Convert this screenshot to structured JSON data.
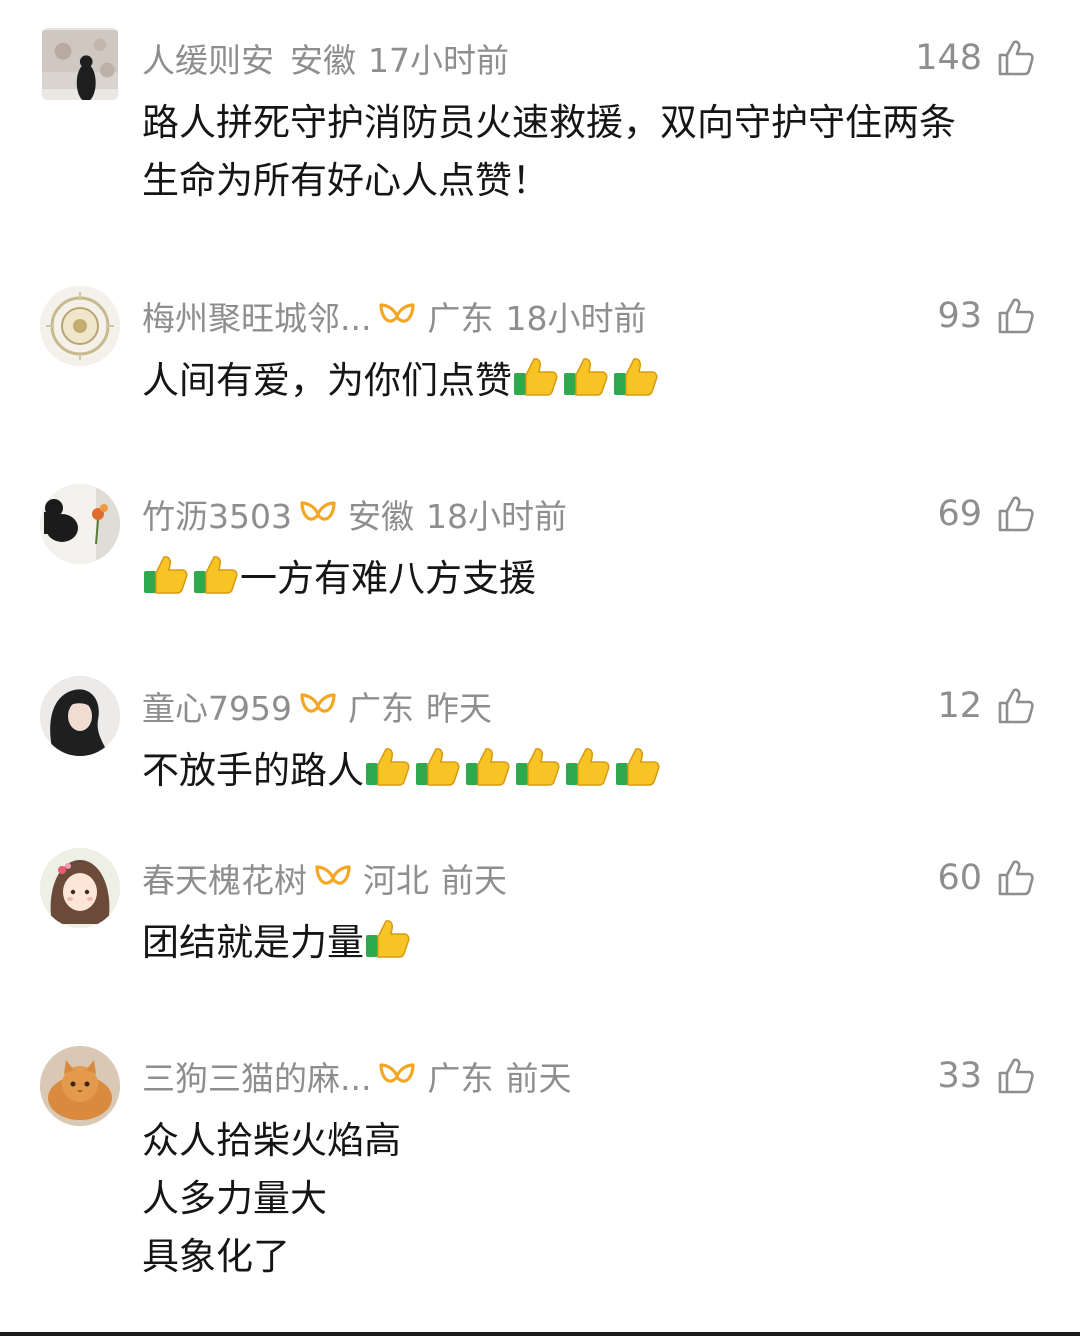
{
  "comments": [
    {
      "user": "人缓则安",
      "location": "安徽",
      "time": "17小时前",
      "likes": "148",
      "lines": [
        "路人拼死守护消防员火速救援，双向守护守住两条",
        "生命为所有好心人点赞！"
      ],
      "badge": false,
      "avatar": "photo-icon",
      "thumbs_after": 0,
      "thumbs_before": 0
    },
    {
      "user": "梅州聚旺城邻...",
      "location": "广东",
      "time": "18小时前",
      "likes": "93",
      "lines": [
        "人间有爱，为你们点赞"
      ],
      "badge": true,
      "avatar": "emblem-icon",
      "thumbs_after": 3,
      "thumbs_before": 0
    },
    {
      "user": "竹沥3503",
      "location": "安徽",
      "time": "18小时前",
      "likes": "69",
      "lines": [
        "一方有难八方支援"
      ],
      "badge": true,
      "avatar": "silhouette-icon",
      "thumbs_after": 0,
      "thumbs_before": 2
    },
    {
      "user": "童心7959",
      "location": "广东",
      "time": "昨天",
      "likes": "12",
      "lines": [
        "不放手的路人"
      ],
      "badge": true,
      "avatar": "portrait-icon",
      "thumbs_after": 6,
      "thumbs_before": 0
    },
    {
      "user": "春天槐花树",
      "location": "河北",
      "time": "前天",
      "likes": "60",
      "lines": [
        "团结就是力量"
      ],
      "badge": true,
      "avatar": "cartoon-girl-icon",
      "thumbs_after": 1,
      "thumbs_before": 0
    },
    {
      "user": "三狗三猫的麻...",
      "location": "广东",
      "time": "前天",
      "likes": "33",
      "lines": [
        "众人拾柴火焰高",
        "人多力量大",
        "具象化了"
      ],
      "badge": true,
      "avatar": "cat-icon",
      "thumbs_after": 0,
      "thumbs_before": 0
    }
  ],
  "colors": {
    "meta_gray": "#8e8e8e",
    "text": "#151515",
    "badge_orange": "#f5a623",
    "thumb_yellow": "#f7c325",
    "thumb_green": "#2fa94d"
  }
}
